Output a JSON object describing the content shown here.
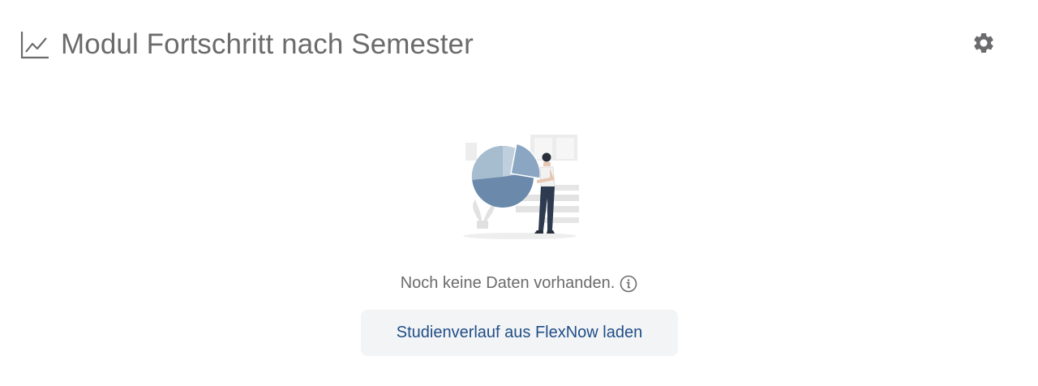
{
  "header": {
    "title": "Modul Fortschritt nach Semester",
    "icon": "line-chart-icon"
  },
  "settings": {
    "icon": "gear-icon"
  },
  "empty_state": {
    "illustration": "person-holding-pie-chart-illustration",
    "message": "Noch keine Daten vorhanden.",
    "info_icon": "info-icon",
    "button_label": "Studienverlauf aus FlexNow laden"
  },
  "colors": {
    "title": "#6b6b6d",
    "button_text": "#1f4e86",
    "button_bg": "#f3f4f6",
    "icon": "#6b6b6d"
  }
}
